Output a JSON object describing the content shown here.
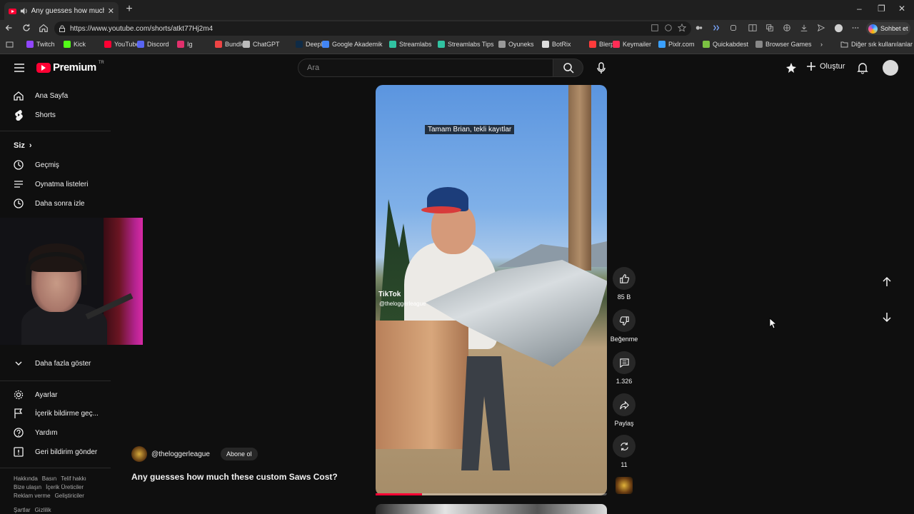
{
  "browser": {
    "tab_title": "Any guesses how much these",
    "url": "https://www.youtube.com/shorts/atkt77Hj2m4",
    "chat_label": "Sohbet et",
    "bookmarks": [
      {
        "label": "Twitch",
        "color": "#9146ff"
      },
      {
        "label": "Kick",
        "color": "#53fc18"
      },
      {
        "label": "YouTube",
        "color": "#ff0033"
      },
      {
        "label": "Discord",
        "color": "#5865f2"
      },
      {
        "label": "Ig",
        "color": "#e1306c"
      },
      {
        "label": "Bundle",
        "color": "#e44"
      },
      {
        "label": "ChatGPT",
        "color": "#bbbbbb"
      },
      {
        "label": "DeepL",
        "color": "#0f2b46"
      },
      {
        "label": "Google Akademik",
        "color": "#4285f4"
      },
      {
        "label": "Streamlabs",
        "color": "#31c3a2"
      },
      {
        "label": "Streamlabs Tips",
        "color": "#31c3a2"
      },
      {
        "label": "Oyuneks",
        "color": "#999999"
      },
      {
        "label": "BotRix",
        "color": "#dddddd"
      },
      {
        "label": "Blerp",
        "color": "#ff3b3b"
      },
      {
        "label": "Keymailer",
        "color": "#ff2d55"
      },
      {
        "label": "Pixlr.com",
        "color": "#3aa0ff"
      },
      {
        "label": "Quickabdest",
        "color": "#7cc242"
      },
      {
        "label": "Browser Games",
        "color": "#888888"
      }
    ],
    "other_bookmarks": "Diğer sık kullanılanlar"
  },
  "header": {
    "logo_word": "Premium",
    "logo_region": "TR",
    "search_placeholder": "Ara",
    "create_label": "Oluştur"
  },
  "sidebar": {
    "items": [
      {
        "label": "Ana Sayfa",
        "icon": "home-icon"
      },
      {
        "label": "Shorts",
        "icon": "shorts-icon"
      }
    ],
    "you_heading": "Siz",
    "you_items": [
      {
        "label": "Geçmiş",
        "icon": "history-icon"
      },
      {
        "label": "Oynatma listeleri",
        "icon": "playlist-icon"
      },
      {
        "label": "Daha sonra izle",
        "icon": "watch-later-icon"
      }
    ],
    "show_more": "Daha fazla göster",
    "bottom_items": [
      {
        "label": "Ayarlar",
        "icon": "gear-icon"
      },
      {
        "label": "İçerik bildirme geç...",
        "icon": "flag-icon"
      },
      {
        "label": "Yardım",
        "icon": "help-icon"
      },
      {
        "label": "Geri bildirim gönder",
        "icon": "feedback-icon"
      }
    ],
    "footer_rows": [
      [
        "Hakkında",
        "Basın",
        "Telif hakkı"
      ],
      [
        "Bize ulaşın",
        "İçerik Üreticiler"
      ],
      [
        "Reklam verme",
        "Geliştiriciler"
      ],
      [
        "Şartlar",
        "Gizlilik"
      ]
    ]
  },
  "short": {
    "caption": "Tamam Brian, tekli kayıtlar",
    "watermark": "TikTok",
    "watermark_user": "@theloggerleague",
    "channel": "@theloggerleague",
    "subscribe": "Abone ol",
    "title": "Any guesses how much these custom Saws Cost?",
    "progress": 0.2,
    "actions": {
      "likes": "85 B",
      "dislike": "Beğenme",
      "comments": "1.326",
      "share": "Paylaş",
      "remix": "11"
    }
  },
  "colors": {
    "accent": "#ff0033",
    "background": "#0f0f0f"
  }
}
